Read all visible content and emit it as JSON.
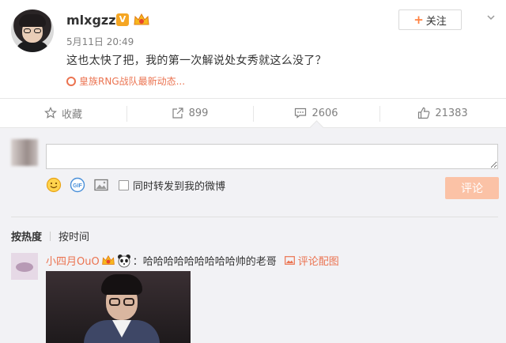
{
  "post": {
    "username": "mlxgzzz",
    "verified_badge": "V",
    "time": "5月11日 20:49",
    "text": "这也太快了把，我的第一次解说处女秀就这么没了？",
    "source": "皇族RNG战队最新动态...",
    "follow_label": "关注",
    "follow_plus": "+"
  },
  "actions": [
    {
      "icon": "star-icon",
      "label": "收藏"
    },
    {
      "icon": "share-icon",
      "label": "899"
    },
    {
      "icon": "comment-icon",
      "label": "2606"
    },
    {
      "icon": "thumbs-up-icon",
      "label": "21383"
    }
  ],
  "composer": {
    "input_value": "",
    "repost_label": "同时转发到我的微博",
    "submit_label": "评论",
    "tools": [
      "emoji-icon",
      "gif-icon",
      "image-icon"
    ]
  },
  "sort": {
    "hot_label": "按热度",
    "time_label": "按时间"
  },
  "comment": {
    "user": "小四月OuO",
    "text": "：哈哈哈哈哈哈哈哈哈帅的老哥",
    "image_link": "评论配图"
  },
  "colors": {
    "accent": "#eb7350",
    "submit_disabled": "#fbc2a6",
    "badge": "#f5a623",
    "panel_bg": "#f2f2f5"
  }
}
